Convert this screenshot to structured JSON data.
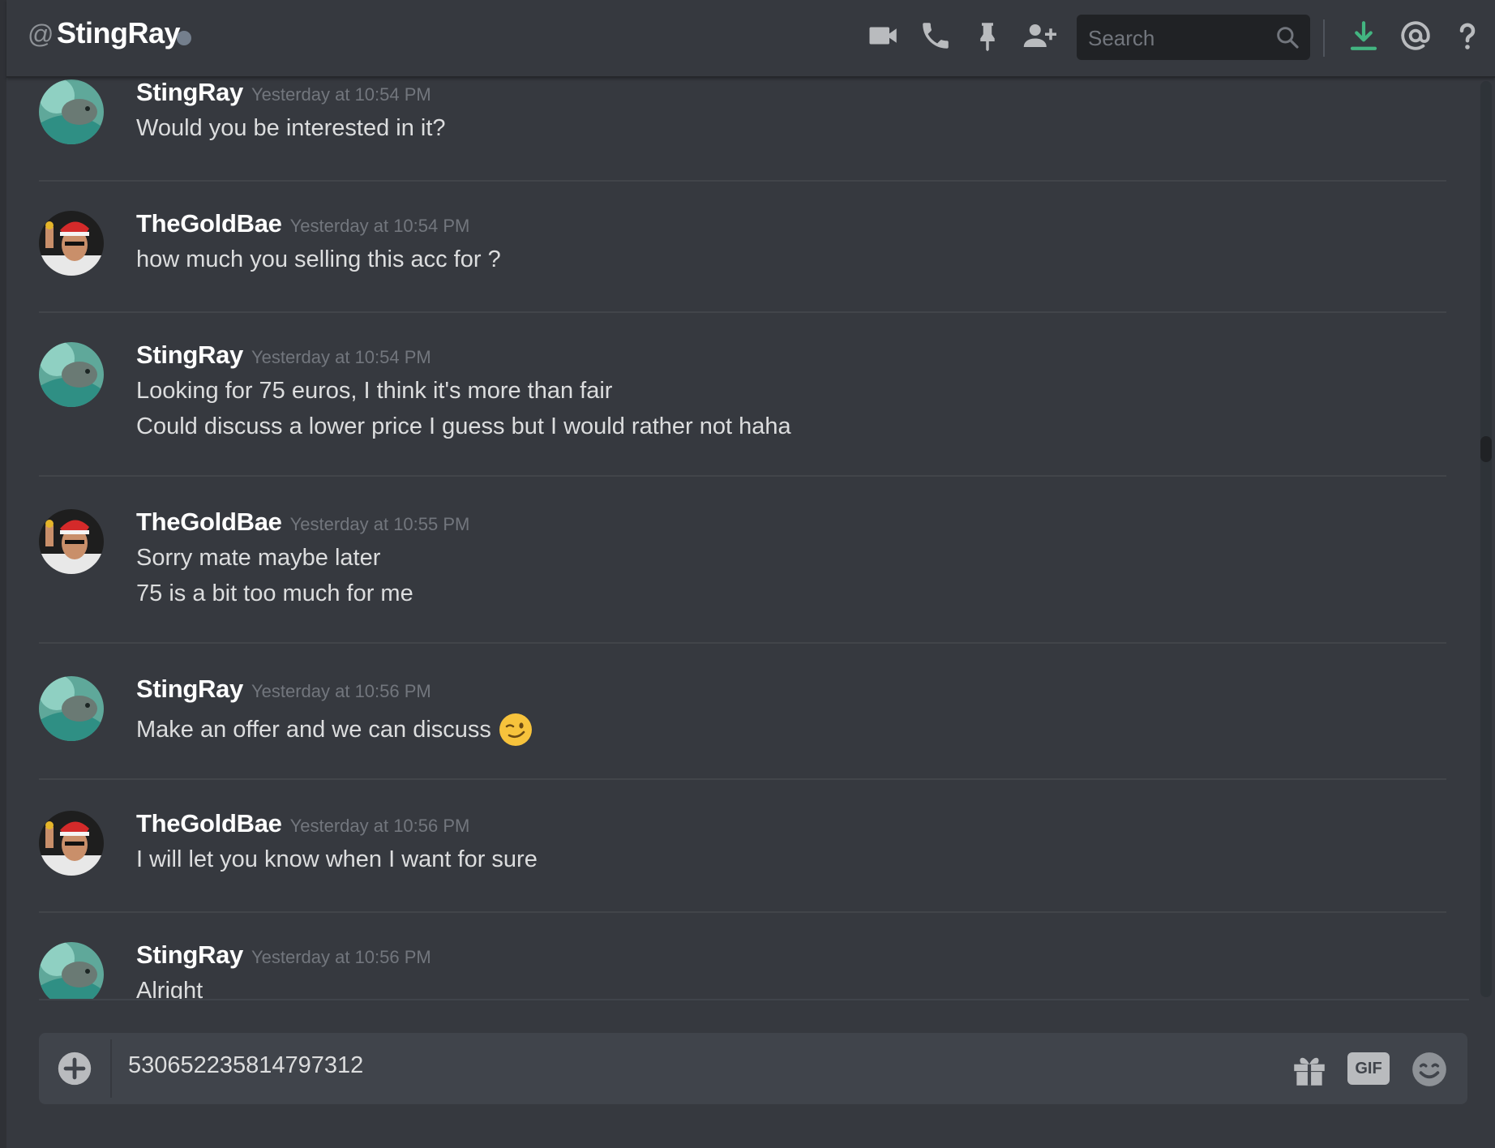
{
  "header": {
    "at_symbol": "@",
    "channel_name": "StingRay",
    "search_placeholder": "Search",
    "icons": [
      "video-call-icon",
      "phone-call-icon",
      "pin-icon",
      "add-friend-icon",
      "search-icon",
      "download-icon",
      "mention-icon",
      "help-icon"
    ]
  },
  "messages": [
    {
      "author": "StingRay",
      "timestamp": "Yesterday at 10:54 PM",
      "lines": [
        "Would you be interested in it?"
      ],
      "avatar": "stingray-avatar"
    },
    {
      "author": "TheGoldBae",
      "timestamp": "Yesterday at 10:54 PM",
      "lines": [
        "how much you selling this acc for ?"
      ],
      "avatar": "goldbae-avatar"
    },
    {
      "author": "StingRay",
      "timestamp": "Yesterday at 10:54 PM",
      "lines": [
        "Looking for 75 euros, I think it's more than fair",
        "Could discuss a lower price I guess but I would rather not haha"
      ],
      "avatar": "stingray-avatar"
    },
    {
      "author": "TheGoldBae",
      "timestamp": "Yesterday at 10:55 PM",
      "lines": [
        "Sorry mate maybe later",
        "75 is a bit too much for me"
      ],
      "avatar": "goldbae-avatar"
    },
    {
      "author": "StingRay",
      "timestamp": "Yesterday at 10:56 PM",
      "lines": [
        "Make an offer and we can discuss"
      ],
      "emoji": "wink-emoji",
      "avatar": "stingray-avatar"
    },
    {
      "author": "TheGoldBae",
      "timestamp": "Yesterday at 10:56 PM",
      "lines": [
        "I will let you know when I want for sure"
      ],
      "avatar": "goldbae-avatar"
    },
    {
      "author": "StingRay",
      "timestamp": "Yesterday at 10:56 PM",
      "lines": [
        "Alright"
      ],
      "avatar": "stingray-avatar"
    }
  ],
  "composer": {
    "value": "530652235814797312",
    "icons": [
      "upload-plus-icon",
      "gift-icon",
      "gif-icon",
      "emoji-picker-icon"
    ],
    "gif_label": "GIF"
  },
  "colors": {
    "background": "#36393f",
    "header_text": "#ffffff",
    "timestamp": "#72767d",
    "message_text": "#dcddde",
    "download_accent": "#43b581",
    "composer_bg": "#40444b"
  }
}
